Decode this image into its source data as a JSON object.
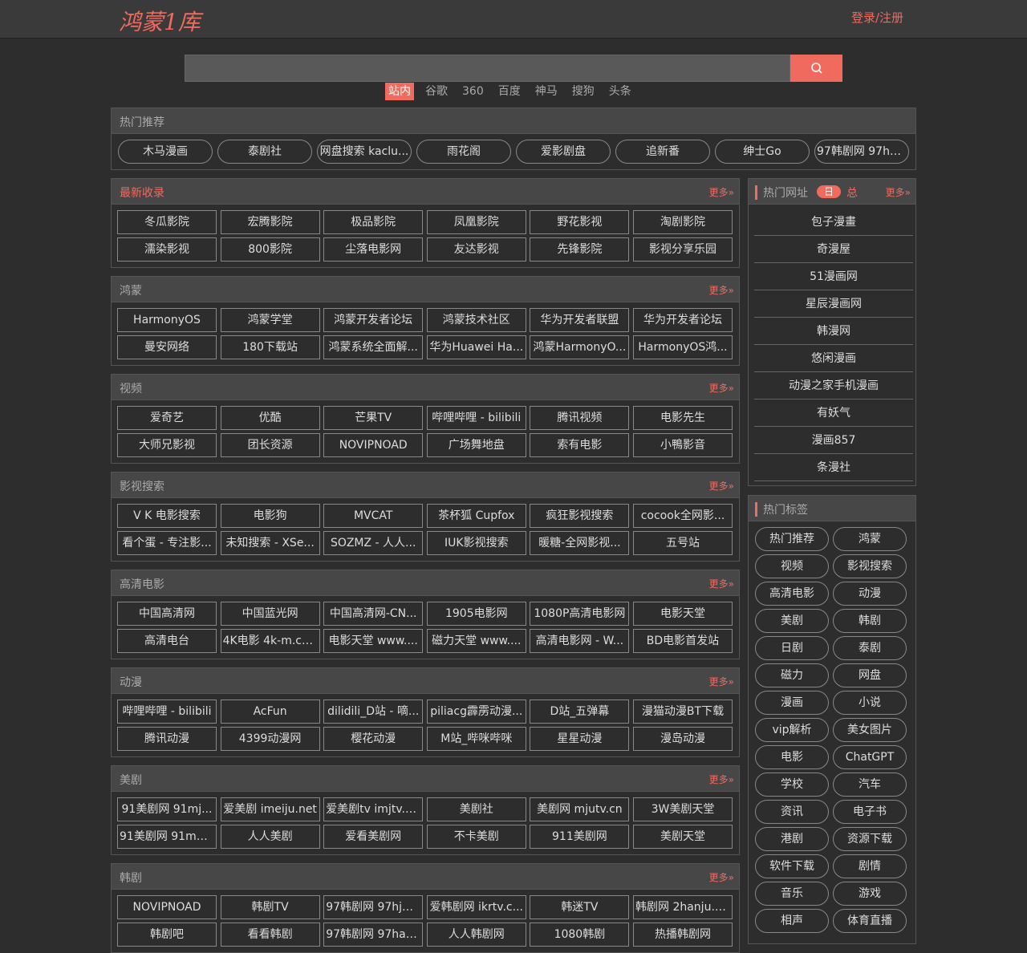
{
  "header": {
    "logo": "鸿蒙1库",
    "login": "登录/注册"
  },
  "search": {
    "placeholder": "",
    "engines": [
      "站内",
      "谷歌",
      "360",
      "百度",
      "神马",
      "搜狗",
      "头条"
    ],
    "active": 0
  },
  "hot": {
    "title": "热门推荐",
    "items": [
      "木马漫画",
      "泰剧社",
      "网盘搜索 kaclu...",
      "雨花阁",
      "爱影剧盘",
      "追新番",
      "绅士Go",
      "97韩剧网 97ha..."
    ]
  },
  "more_label": "更多»",
  "sections": [
    {
      "title": "最新收录",
      "title_red": true,
      "rows": [
        [
          "冬瓜影院",
          "宏腾影院",
          "极品影院",
          "凤凰影院",
          "野花影视",
          "淘剧影院"
        ],
        [
          "濡染影视",
          "800影院",
          "尘落电影网",
          "友达影视",
          "先锋影院",
          "影视分享乐园"
        ]
      ]
    },
    {
      "title": "鸿蒙",
      "rows": [
        [
          "HarmonyOS",
          "鸿蒙学堂",
          "鸿蒙开发者论坛",
          "鸿蒙技术社区",
          "华为开发者联盟",
          "华为开发者论坛"
        ],
        [
          "曼安网络",
          "180下载站",
          "鸿蒙系统全面解...",
          "华为Huawei Ha...",
          "鸿蒙HarmonyO...",
          "HarmonyOS鸿..."
        ]
      ]
    },
    {
      "title": "视频",
      "rows": [
        [
          "爱奇艺",
          "优酷",
          "芒果TV",
          "哔哩哔哩 - bilibili",
          "腾讯视频",
          "电影先生"
        ],
        [
          "大师兄影视",
          "团长资源",
          "NOVIPNOAD",
          "广场舞地盘",
          "索有电影",
          "小鴨影音"
        ]
      ]
    },
    {
      "title": "影视搜索",
      "rows": [
        [
          "V K 电影搜索",
          "电影狗",
          "MVCAT",
          "茶杯狐 Cupfox",
          "疯狂影视搜索",
          "cocook全网影..."
        ],
        [
          "看个蛋 - 专注影...",
          "未知搜索 - XSe...",
          "SOZMZ - 人人...",
          "IUK影视搜索",
          "暖糖-全网影视...",
          "五号站"
        ]
      ]
    },
    {
      "title": "高清电影",
      "rows": [
        [
          "中国高清网",
          "中国蓝光网",
          "中国高清网-CN...",
          "1905电影网",
          "1080P高清电影网",
          "电影天堂"
        ],
        [
          "高清电台",
          "4K电影 4k-m.com",
          "电影天堂 www....",
          "磁力天堂 www....",
          "高清电影网 - W...",
          "BD电影首发站"
        ]
      ]
    },
    {
      "title": "动漫",
      "rows": [
        [
          "哔哩哔哩 - bilibili",
          "AcFun",
          "dilidili_D站 - 嘀...",
          "piliacg霹雳动漫...",
          "D站_五弹幕",
          "漫猫动漫BT下载"
        ],
        [
          "腾讯动漫",
          "4399动漫网",
          "樱花动漫",
          "M站_哔咪哔咪",
          "星星动漫",
          "漫岛动漫"
        ]
      ]
    },
    {
      "title": "美剧",
      "rows": [
        [
          "91美剧网 91mj...",
          "爱美剧 imeiju.net",
          "爱美剧tv imjtv.c...",
          "美剧社",
          "美剧网 mjutv.cn",
          "3W美剧天堂"
        ],
        [
          "91美剧网 91mei...",
          "人人美剧",
          "爱看美剧网",
          "不卡美剧",
          "911美剧网",
          "美剧天堂"
        ]
      ]
    },
    {
      "title": "韩剧",
      "rows": [
        [
          "NOVIPNOAD",
          "韩剧TV",
          "97韩剧网 97hjw...",
          "爱韩剧网 ikrtv.c...",
          "韩迷TV",
          "韩剧网 2hanju.c..."
        ],
        [
          "韩剧吧",
          "看看韩剧",
          "97韩剧网 97han...",
          "人人韩剧网",
          "1080韩剧",
          "热播韩剧网"
        ]
      ]
    }
  ],
  "sites": {
    "title": "热门网址",
    "day": "日",
    "total": "总",
    "items": [
      "包子漫畫",
      "奇漫屋",
      "51漫画网",
      "星辰漫画网",
      "韩漫网",
      "悠闲漫画",
      "动漫之家手机漫画",
      "有妖气",
      "漫画857",
      "条漫社"
    ]
  },
  "tags": {
    "title": "热门标签",
    "items": [
      "热门推荐",
      "鸿蒙",
      "视频",
      "影视搜索",
      "高清电影",
      "动漫",
      "美剧",
      "韩剧",
      "日剧",
      "泰剧",
      "磁力",
      "网盘",
      "漫画",
      "小说",
      "vip解析",
      "美女图片",
      "电影",
      "ChatGPT",
      "学校",
      "汽车",
      "资讯",
      "电子书",
      "港剧",
      "资源下载",
      "软件下载",
      "剧情",
      "音乐",
      "游戏",
      "相声",
      "体育直播"
    ]
  }
}
